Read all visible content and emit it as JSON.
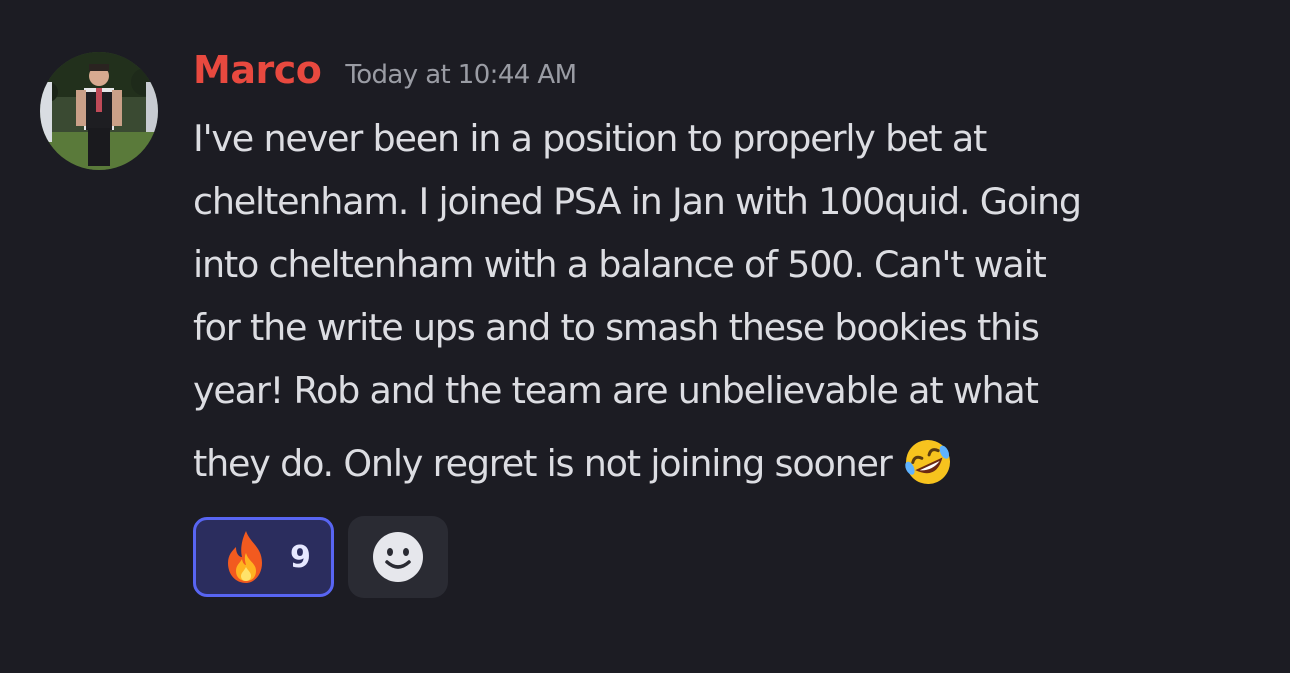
{
  "message": {
    "author": "Marco",
    "timestamp": "Today at 10:44 AM",
    "lines": [
      "I've never been in a position to properly bet at",
      "cheltenham. I joined PSA in Jan with 100quid. Going",
      "into cheltenham with a balance of 500. Can't wait",
      "for the write ups and to smash these bookies this",
      "year! Rob and the team are unbelievable at what",
      "they do. Only regret is not joining sooner"
    ],
    "inline_emoji": "rolling-on-the-floor-laughing"
  },
  "reactions": [
    {
      "emoji": "fire",
      "count": "9",
      "active": true
    }
  ],
  "add_reaction_icon": "smiley-face-icon",
  "colors": {
    "background": "#1c1c23",
    "username": "#e8493f",
    "text": "#dcdde2",
    "timestamp": "#9a9ca4",
    "reaction_border": "#5865f2",
    "reaction_bg": "#2b2d5e"
  }
}
